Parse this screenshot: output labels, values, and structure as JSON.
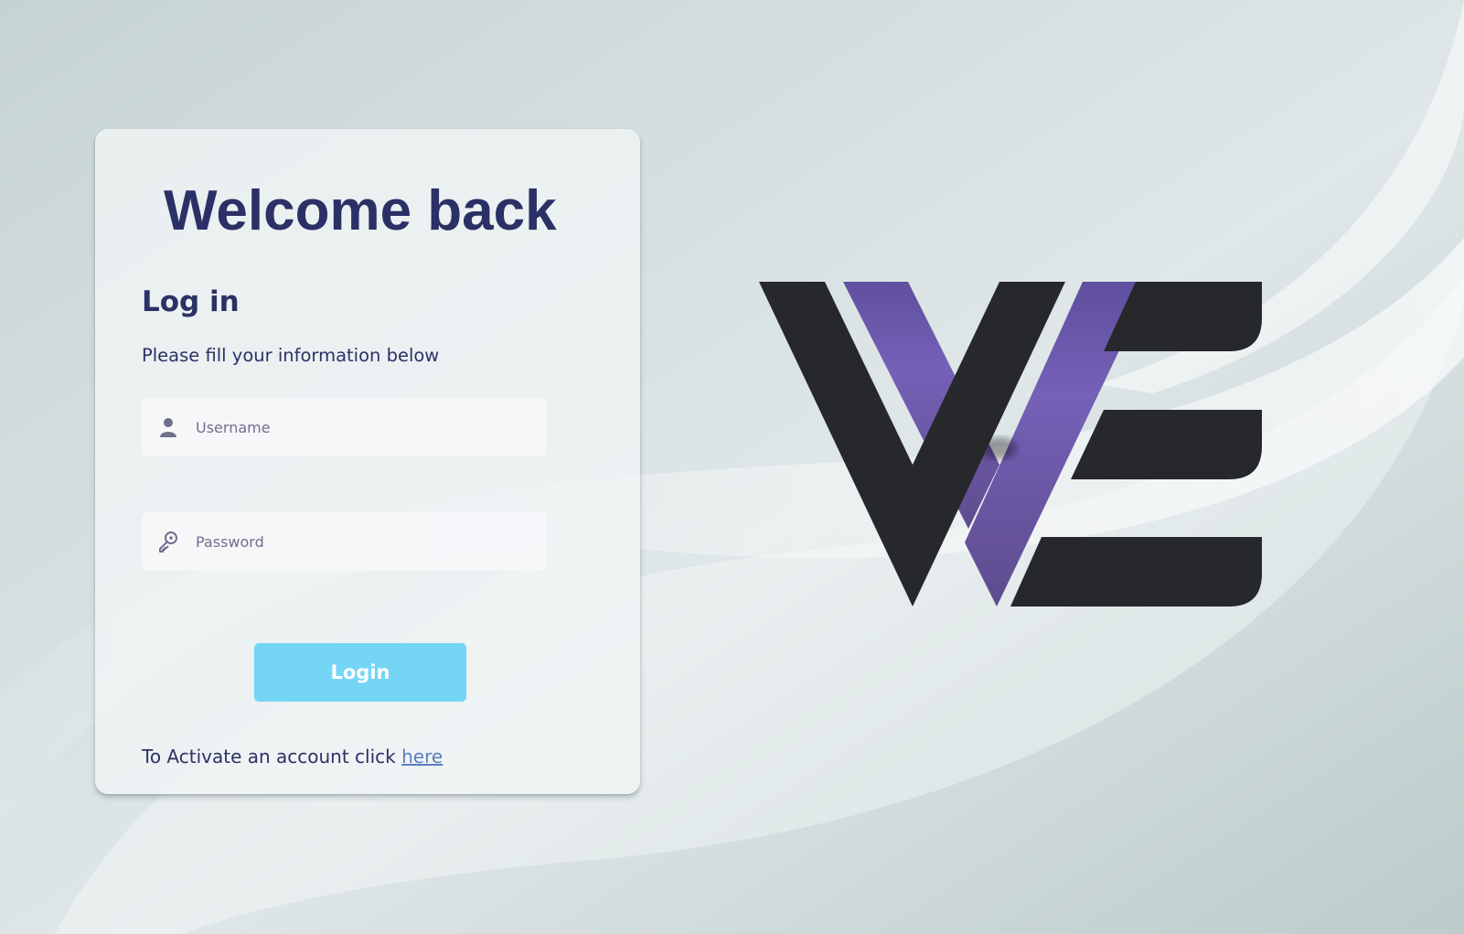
{
  "card": {
    "title": "Welcome back",
    "heading": "Log in",
    "subtitle": "Please fill your information below"
  },
  "username": {
    "placeholder": "Username",
    "icon": "user-icon"
  },
  "password": {
    "placeholder": "Password",
    "icon": "key-icon"
  },
  "login_button": {
    "label": "Login"
  },
  "activate": {
    "text": "To Activate an account click",
    "link_label": "here"
  },
  "logo": {
    "icon": "we-logo"
  },
  "colors": {
    "background": "#c3d1d2",
    "heading": "#2b3166",
    "button": "#74d5f5",
    "link": "#5b7fbe",
    "logo_dark": "#27282b",
    "logo_accent": "#7561b8"
  }
}
